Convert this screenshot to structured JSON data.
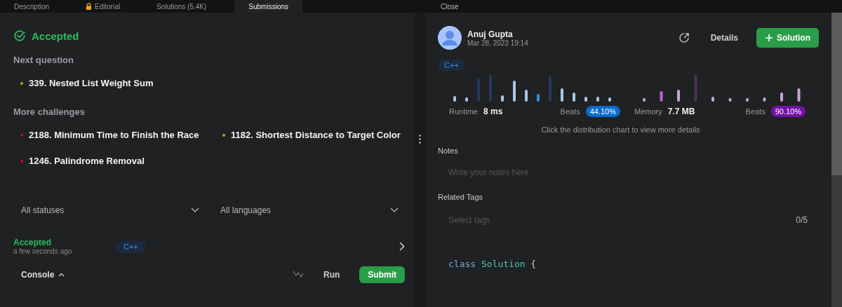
{
  "tabs": [
    {
      "label": "Description",
      "locked": false,
      "selected": false
    },
    {
      "label": "Editorial",
      "locked": true,
      "selected": false
    },
    {
      "label": "Solutions (5.4K)",
      "locked": false,
      "selected": false
    },
    {
      "label": "Submissions",
      "locked": false,
      "selected": true
    }
  ],
  "close_label": "Close",
  "result": {
    "status": "Accepted"
  },
  "next_question": {
    "heading": "Next question",
    "items": [
      {
        "title": "339. Nested List Weight Sum",
        "color": "#c59a1c"
      }
    ]
  },
  "more_challenges": {
    "heading": "More challenges",
    "items": [
      {
        "title": "2188. Minimum Time to Finish the Race",
        "color": "#c0122b"
      },
      {
        "title": "1182. Shortest Distance to Target Color",
        "color": "#c59a1c"
      },
      {
        "title": "1246. Palindrome Removal",
        "color": "#c0122b"
      }
    ]
  },
  "filters": [
    "All statuses",
    "All languages"
  ],
  "submission": {
    "status": "Accepted",
    "time": "a few seconds ago",
    "language": "C++"
  },
  "console": {
    "label": "Console",
    "buttons": [
      "Run",
      "Submit"
    ]
  },
  "detail": {
    "author": "Anuj Gupta",
    "date": "Mar 28, 2023 19:14",
    "details_label": "Details",
    "solution_label": "Solution",
    "language": "C++",
    "runtime": {
      "label": "Runtime",
      "value": "8 ms",
      "beats_label": "Beats",
      "beats": "44.10%"
    },
    "memory": {
      "label": "Memory",
      "value": "7.7 MB",
      "beats_label": "Beats",
      "beats": "90.10%"
    },
    "hint": "Click the distribution chart to view more details",
    "notes_heading": "Notes",
    "notes_placeholder": "Write your notes here",
    "tags_heading": "Related Tags",
    "tags_placeholder": "Select tags",
    "tags_count": "0/5"
  },
  "code": [
    {
      "kind": "keyword",
      "text": "class"
    },
    {
      "kind": "type",
      "text": "Solution"
    },
    {
      "kind": "punct",
      "text": "{"
    }
  ]
}
